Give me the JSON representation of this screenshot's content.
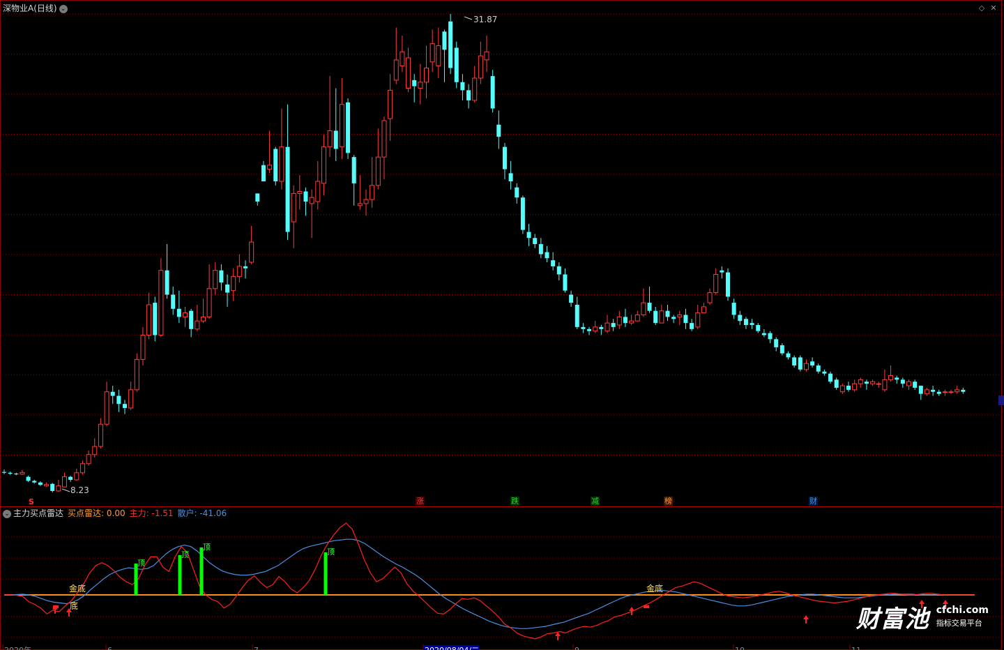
{
  "header": {
    "title": "深物业A(日线)",
    "price_high_label": "31.87",
    "price_low_label": "8.23"
  },
  "events": {
    "s_marker": "S",
    "items": [
      "涨",
      "跌",
      "减",
      "榜",
      "财"
    ],
    "colors": [
      "#ff3333",
      "#33cc33",
      "#33cc33",
      "#ff9933",
      "#3399ff"
    ]
  },
  "indicator": {
    "name": "主力买点雷达",
    "buy_radar_label": "买点雷达:",
    "buy_radar_value": "0.00",
    "main_label": "主力:",
    "main_value": "-1.51",
    "retail_label": "散户:",
    "retail_value": "-41.06",
    "signal_golden_bottom": "金底",
    "signal_bottom": "底",
    "signal_top": "顶"
  },
  "xaxis": {
    "labels": [
      "2020年",
      "6",
      "7",
      "2020/08/04/二",
      "9",
      "10",
      "11"
    ]
  },
  "brand": {
    "name": "财富池",
    "url": "cfchi.com",
    "slogan": "指标交易平台"
  },
  "colors": {
    "up": "#ff3d3d",
    "down": "#54fcfc",
    "grid": "#8b0000",
    "main_line": "#ff2020",
    "retail_line": "#4a90e2",
    "zero_line": "#ff8c1a",
    "top_bar": "#00ff00"
  },
  "chart_data": {
    "type": "candlestick",
    "price_range": [
      8.23,
      31.87
    ],
    "candles": [
      [
        9.24,
        9.2,
        9.36,
        9.12
      ],
      [
        9.2,
        9.15,
        9.26,
        9.1
      ],
      [
        9.16,
        9.12,
        9.2,
        9.08
      ],
      [
        9.13,
        9.22,
        9.34,
        9.1
      ],
      [
        9.0,
        8.8,
        9.06,
        8.74
      ],
      [
        8.8,
        8.72,
        8.86,
        8.66
      ],
      [
        8.72,
        8.6,
        8.78,
        8.55
      ],
      [
        8.55,
        8.62,
        8.72,
        8.5
      ],
      [
        8.65,
        8.3,
        8.7,
        8.23
      ],
      [
        8.3,
        8.55,
        8.85,
        8.25
      ],
      [
        8.5,
        9.0,
        9.2,
        8.48
      ],
      [
        9.0,
        8.85,
        9.05,
        8.75
      ],
      [
        8.85,
        9.2,
        9.4,
        8.8
      ],
      [
        9.2,
        9.65,
        9.8,
        9.1
      ],
      [
        9.65,
        10.1,
        10.3,
        9.55
      ],
      [
        10.1,
        10.5,
        10.9,
        9.95
      ],
      [
        10.5,
        11.6,
        11.9,
        10.4
      ],
      [
        11.6,
        13.2,
        13.7,
        11.5
      ],
      [
        13.2,
        13.0,
        13.5,
        12.6
      ],
      [
        13.0,
        12.6,
        13.3,
        12.2
      ],
      [
        12.6,
        12.4,
        12.8,
        12.1
      ],
      [
        12.4,
        13.3,
        13.7,
        12.3
      ],
      [
        13.3,
        14.8,
        15.1,
        13.2
      ],
      [
        14.8,
        16.0,
        16.4,
        14.5
      ],
      [
        16.0,
        17.5,
        18.1,
        15.8
      ],
      [
        17.6,
        16.0,
        17.9,
        15.7
      ],
      [
        16.0,
        19.2,
        19.8,
        15.9
      ],
      [
        19.2,
        18.0,
        20.5,
        17.8
      ],
      [
        18.0,
        17.3,
        18.4,
        17.0
      ],
      [
        17.3,
        16.9,
        18.2,
        16.6
      ],
      [
        16.9,
        17.1,
        17.4,
        16.4
      ],
      [
        17.2,
        16.3,
        17.3,
        15.9
      ],
      [
        16.3,
        16.7,
        17.5,
        16.2
      ],
      [
        16.7,
        16.9,
        17.8,
        16.6
      ],
      [
        16.9,
        18.3,
        19.5,
        16.8
      ],
      [
        18.3,
        19.2,
        19.6,
        18.0
      ],
      [
        19.2,
        18.6,
        19.5,
        18.2
      ],
      [
        18.5,
        18.1,
        19.0,
        17.4
      ],
      [
        18.2,
        18.9,
        19.3,
        17.7
      ],
      [
        18.9,
        19.4,
        20.0,
        18.6
      ],
      [
        19.4,
        19.3,
        19.7,
        18.8
      ],
      [
        19.6,
        20.6,
        21.4,
        19.5
      ],
      [
        23.0,
        22.6,
        23.0,
        22.4
      ],
      [
        24.4,
        23.6,
        24.6,
        23.6
      ],
      [
        24.2,
        24.4,
        26.1,
        24.0
      ],
      [
        25.2,
        23.6,
        25.3,
        23.4
      ],
      [
        23.6,
        25.3,
        27.2,
        23.2
      ],
      [
        25.3,
        21.1,
        27.4,
        20.7
      ],
      [
        21.6,
        23.0,
        23.4,
        20.3
      ],
      [
        23.0,
        23.1,
        23.9,
        22.2
      ],
      [
        23.1,
        22.6,
        23.3,
        21.9
      ],
      [
        22.5,
        22.8,
        23.2,
        20.8
      ],
      [
        22.6,
        23.6,
        24.6,
        22.2
      ],
      [
        23.5,
        25.3,
        25.9,
        22.9
      ],
      [
        25.3,
        26.1,
        28.8,
        24.8
      ],
      [
        26.1,
        25.2,
        28.2,
        24.6
      ],
      [
        25.3,
        27.4,
        28.7,
        24.7
      ],
      [
        27.5,
        25.0,
        27.7,
        24.7
      ],
      [
        24.8,
        23.5,
        24.9,
        22.4
      ],
      [
        22.4,
        22.5,
        23.9,
        22.2
      ],
      [
        22.5,
        22.7,
        23.2,
        21.9
      ],
      [
        22.7,
        23.4,
        24.8,
        22.3
      ],
      [
        23.4,
        24.8,
        26.2,
        23.2
      ],
      [
        24.8,
        26.6,
        26.8,
        23.7
      ],
      [
        26.7,
        28.1,
        28.9,
        25.6
      ],
      [
        28.6,
        29.6,
        31.2,
        28.4
      ],
      [
        29.3,
        30.0,
        30.8,
        29.0
      ],
      [
        28.2,
        29.7,
        30.2,
        28.0
      ],
      [
        28.6,
        28.3,
        28.9,
        27.5
      ],
      [
        28.2,
        28.5,
        29.4,
        27.4
      ],
      [
        28.5,
        29.2,
        30.3,
        27.7
      ],
      [
        29.5,
        30.4,
        31.1,
        29.0
      ],
      [
        29.3,
        30.3,
        31.2,
        28.7
      ],
      [
        31.0,
        30.1,
        31.1,
        28.5
      ],
      [
        31.5,
        29.2,
        31.87,
        28.9
      ],
      [
        30.2,
        28.5,
        30.5,
        28.2
      ],
      [
        28.5,
        28.1,
        28.9,
        27.6
      ],
      [
        28.1,
        27.6,
        28.4,
        27.2
      ],
      [
        27.6,
        28.7,
        29.3,
        27.5
      ],
      [
        28.7,
        29.8,
        30.5,
        28.4
      ],
      [
        29.6,
        30.0,
        30.8,
        29.0
      ],
      [
        28.8,
        27.2,
        29.1,
        27.0
      ],
      [
        26.4,
        25.8,
        27.1,
        25.2
      ],
      [
        25.3,
        24.2,
        25.5,
        23.7
      ],
      [
        24.0,
        23.6,
        24.6,
        23.2
      ],
      [
        23.3,
        22.8,
        23.5,
        22.5
      ],
      [
        22.8,
        21.2,
        22.9,
        21.0
      ],
      [
        21.1,
        20.8,
        21.5,
        20.4
      ],
      [
        20.8,
        20.5,
        21.0,
        20.3
      ],
      [
        20.5,
        20.0,
        20.8,
        19.8
      ],
      [
        20.1,
        19.8,
        20.4,
        19.6
      ],
      [
        19.7,
        19.4,
        20.1,
        19.2
      ],
      [
        19.4,
        19.0,
        19.6,
        18.7
      ],
      [
        19.0,
        18.2,
        19.3,
        18.1
      ],
      [
        18.0,
        17.6,
        18.2,
        17.4
      ],
      [
        17.5,
        16.4,
        17.9,
        16.3
      ],
      [
        16.4,
        16.3,
        16.6,
        16.1
      ],
      [
        16.3,
        16.2,
        16.4,
        16.0
      ],
      [
        16.2,
        16.4,
        16.7,
        16.1
      ],
      [
        16.4,
        16.3,
        16.5,
        16.0
      ],
      [
        16.2,
        16.6,
        17.0,
        16.1
      ],
      [
        16.6,
        16.4,
        16.8,
        16.2
      ],
      [
        16.5,
        16.9,
        17.2,
        16.3
      ],
      [
        16.9,
        16.6,
        17.3,
        16.4
      ],
      [
        16.6,
        16.7,
        17.0,
        16.5
      ],
      [
        16.7,
        17.0,
        17.2,
        16.7
      ],
      [
        17.0,
        17.6,
        18.3,
        16.9
      ],
      [
        17.6,
        17.2,
        18.4,
        17.1
      ],
      [
        17.2,
        16.6,
        17.4,
        16.5
      ],
      [
        16.6,
        17.2,
        17.5,
        16.6
      ],
      [
        17.2,
        16.9,
        17.5,
        16.7
      ],
      [
        16.9,
        16.8,
        17.0,
        16.6
      ],
      [
        16.9,
        17.0,
        17.2,
        16.5
      ],
      [
        17.0,
        16.6,
        17.3,
        16.3
      ],
      [
        16.6,
        16.3,
        16.8,
        16.2
      ],
      [
        16.4,
        17.1,
        17.5,
        16.3
      ],
      [
        17.1,
        17.4,
        17.6,
        17.2
      ],
      [
        17.6,
        18.1,
        18.3,
        17.5
      ],
      [
        18.1,
        19.0,
        19.3,
        18.0
      ],
      [
        19.2,
        19.1,
        19.4,
        18.8
      ],
      [
        19.1,
        17.9,
        19.3,
        17.7
      ],
      [
        17.6,
        17.0,
        17.8,
        16.8
      ],
      [
        17.0,
        16.7,
        17.2,
        16.5
      ],
      [
        16.8,
        16.5,
        16.9,
        16.3
      ],
      [
        16.6,
        16.5,
        16.8,
        16.3
      ],
      [
        16.5,
        16.2,
        16.6,
        16.1
      ],
      [
        16.1,
        16.0,
        16.3,
        15.9
      ],
      [
        16.1,
        15.8,
        16.2,
        15.6
      ],
      [
        15.8,
        15.4,
        15.9,
        15.2
      ],
      [
        15.5,
        15.1,
        15.6,
        15.0
      ],
      [
        15.1,
        14.9,
        15.2,
        14.8
      ],
      [
        14.9,
        14.5,
        15.0,
        14.4
      ],
      [
        14.9,
        14.3,
        15.0,
        14.2
      ],
      [
        14.3,
        14.6,
        14.8,
        14.2
      ],
      [
        14.7,
        14.5,
        14.9,
        14.4
      ],
      [
        14.5,
        14.2,
        14.6,
        14.1
      ],
      [
        14.2,
        14.1,
        14.3,
        14.0
      ],
      [
        14.1,
        13.7,
        14.2,
        13.6
      ],
      [
        13.8,
        13.4,
        13.9,
        13.3
      ],
      [
        13.2,
        13.5,
        13.6,
        13.1
      ],
      [
        13.5,
        13.3,
        13.7,
        13.2
      ],
      [
        13.3,
        13.6,
        13.8,
        13.2
      ],
      [
        13.6,
        13.8,
        13.9,
        13.4
      ],
      [
        13.7,
        13.6,
        13.8,
        13.3
      ],
      [
        13.6,
        13.7,
        13.8,
        13.5
      ],
      [
        13.6,
        13.6,
        13.7,
        13.4
      ],
      [
        13.3,
        13.8,
        14.3,
        13.2
      ],
      [
        13.8,
        14.0,
        14.5,
        13.7
      ],
      [
        13.9,
        13.8,
        14.0,
        13.6
      ],
      [
        13.8,
        13.6,
        13.9,
        13.4
      ],
      [
        13.5,
        13.7,
        13.8,
        13.3
      ],
      [
        13.7,
        13.4,
        13.8,
        13.3
      ],
      [
        13.5,
        13.1,
        13.5,
        12.8
      ],
      [
        13.1,
        13.3,
        13.4,
        13.0
      ],
      [
        13.3,
        13.2,
        13.5,
        13.0
      ],
      [
        13.2,
        13.1,
        13.3,
        13.0
      ],
      [
        13.2,
        13.2,
        13.3,
        13.0
      ],
      [
        13.2,
        13.2,
        13.3,
        13.1
      ],
      [
        13.2,
        13.3,
        13.5,
        13.1
      ],
      [
        13.3,
        13.2,
        13.4,
        13.1
      ]
    ],
    "indicator_series": {
      "main": [
        0,
        0.2,
        -0.5,
        -2,
        -9,
        -13,
        -18,
        -26,
        -21,
        -23,
        -15,
        -8,
        3,
        15,
        30,
        40,
        44,
        40,
        33,
        24,
        18,
        14,
        22,
        40,
        52,
        52,
        38,
        32,
        52,
        66,
        58,
        35,
        12,
        0,
        -6,
        -9,
        -18,
        -13,
        -2,
        10,
        20,
        26,
        17,
        10,
        14,
        25,
        18,
        8,
        3,
        10,
        20,
        36,
        55,
        70,
        82,
        92,
        98,
        90,
        70,
        48,
        30,
        18,
        22,
        30,
        38,
        30,
        15,
        5,
        -2,
        -10,
        -18,
        -25,
        -26,
        -20,
        -12,
        -5,
        -6,
        -4,
        -8,
        -15,
        -22,
        -30,
        -40,
        -45,
        -52,
        -56,
        -58,
        -60,
        -57,
        -53,
        -52,
        -50,
        -52,
        -48,
        -45,
        -43,
        -44,
        -42,
        -38,
        -35,
        -30,
        -28,
        -25,
        -22,
        -18,
        -14,
        -10,
        -5,
        0,
        5,
        10,
        12,
        15,
        18,
        16,
        12,
        8,
        4,
        0,
        -2,
        -3,
        -4,
        -3,
        -2,
        0,
        2,
        4,
        5,
        3,
        0,
        -2,
        -4,
        -6,
        -8,
        -9,
        -10,
        -11,
        -10,
        -9,
        -7,
        -5,
        -3,
        -1,
        0,
        1,
        2,
        2,
        1,
        0,
        0,
        1,
        2,
        2,
        1,
        0,
        0,
        0,
        0,
        0,
        0
      ],
      "retail": [
        0,
        0,
        0.5,
        1,
        0,
        -2,
        -5,
        -8,
        -10,
        -11,
        -12,
        -10,
        -6,
        0,
        8,
        15,
        22,
        28,
        32,
        35,
        37,
        36,
        35,
        36,
        40,
        48,
        56,
        62,
        66,
        68,
        66,
        60,
        52,
        44,
        38,
        33,
        30,
        28,
        27,
        27,
        28,
        30,
        32,
        36,
        40,
        46,
        52,
        58,
        63,
        66,
        68,
        70,
        72,
        74,
        75,
        76,
        76,
        74,
        70,
        64,
        58,
        52,
        47,
        42,
        38,
        33,
        28,
        22,
        15,
        8,
        1,
        -5,
        -10,
        -15,
        -20,
        -24,
        -28,
        -32,
        -36,
        -39,
        -42,
        -44,
        -45,
        -46,
        -46,
        -45,
        -44,
        -43,
        -41,
        -39,
        -37,
        -34,
        -31,
        -28,
        -25,
        -21,
        -17,
        -13,
        -9,
        -5,
        -2,
        0,
        2,
        4,
        5,
        6,
        6,
        5,
        4,
        2,
        0,
        -2,
        -4,
        -6,
        -8,
        -10,
        -12,
        -14,
        -15,
        -15,
        -14,
        -12,
        -10,
        -8,
        -6,
        -4,
        -2,
        -1,
        0,
        1,
        1,
        0,
        -1,
        -2,
        -3,
        -4,
        -4,
        -4,
        -3,
        -2,
        -1,
        0,
        0,
        1,
        1,
        1,
        1,
        0,
        0,
        0,
        0,
        0,
        0,
        0,
        0,
        0,
        0
      ]
    }
  }
}
